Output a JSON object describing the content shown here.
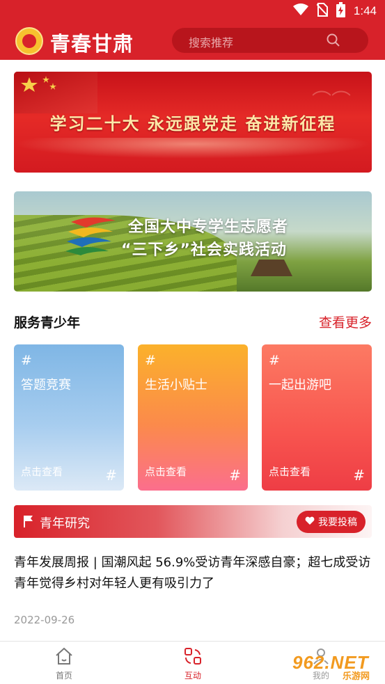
{
  "status_bar": {
    "time": "1:44",
    "icons": [
      "wifi-icon",
      "no-sim-icon",
      "battery-charging-icon"
    ]
  },
  "app_bar": {
    "title": "青春甘肃",
    "search_placeholder": "搜索推荐",
    "logo_icon": "youth-league-emblem-icon",
    "search_icon": "search-icon"
  },
  "banners": [
    {
      "text": "学习二十大  永远跟党走  奋进新征程"
    },
    {
      "line1": "全国大中专学生志愿者",
      "line2": "“三下乡”社会实践活动"
    }
  ],
  "services": {
    "title": "服务青少年",
    "more": "查看更多",
    "cards": [
      {
        "hash": "#",
        "label": "答题竞赛",
        "sub": "点击查看",
        "hash_end": "#"
      },
      {
        "hash": "#",
        "label": "生活小贴士",
        "sub": "点击查看",
        "hash_end": "#"
      },
      {
        "hash": "#",
        "label": "一起出游吧",
        "sub": "点击查看",
        "hash_end": "#"
      }
    ]
  },
  "research": {
    "title": "青年研究",
    "submit_label": "我要投稿",
    "flag_icon": "flag-icon",
    "heart_icon": "heart-icon"
  },
  "news": {
    "title": "青年发展周报 | 国潮风起 56.9%受访青年深感自豪；超七成受访青年觉得乡村对年轻人更有吸引力了",
    "date": "2022-09-26"
  },
  "tab_bar": {
    "tabs": [
      {
        "label": "首页",
        "icon": "home-icon"
      },
      {
        "label": "互动",
        "icon": "interaction-icon"
      },
      {
        "label": "我的",
        "icon": "user-icon"
      }
    ]
  },
  "watermark": {
    "text": "962.NET",
    "sub": "乐游网"
  },
  "colors": {
    "brand_red": "#d8222a",
    "search_bg": "#b8151c",
    "date_gray": "#999999"
  }
}
